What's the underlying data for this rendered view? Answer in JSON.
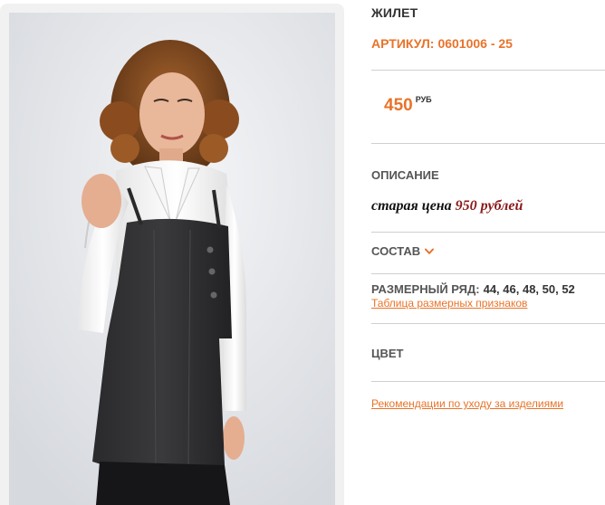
{
  "product": {
    "name": "ЖИЛЕТ",
    "article_label": "АРТИКУЛ:",
    "article_value": "0601006 - 25",
    "price_amount": "450",
    "price_currency": "РУБ",
    "photo_alt": "product-photo"
  },
  "description": {
    "title": "ОПИСАНИЕ",
    "old_price_text": "старая цена",
    "old_price_value": "950 рублей"
  },
  "composition": {
    "title": "СОСТАВ",
    "icon": "chevron-down-icon"
  },
  "sizes": {
    "label": "РАЗМЕРНЫЙ РЯД:",
    "values": "44, 46, 48, 50, 52",
    "table_link": "Таблица размерных признаков"
  },
  "color": {
    "title": "ЦВЕТ"
  },
  "care": {
    "link": "Рекомендации по уходу за изделиями"
  },
  "colors": {
    "accent": "#e8732a",
    "heading": "#555555",
    "old_price": "#8b1a1a",
    "divider": "#cfcfcf"
  }
}
